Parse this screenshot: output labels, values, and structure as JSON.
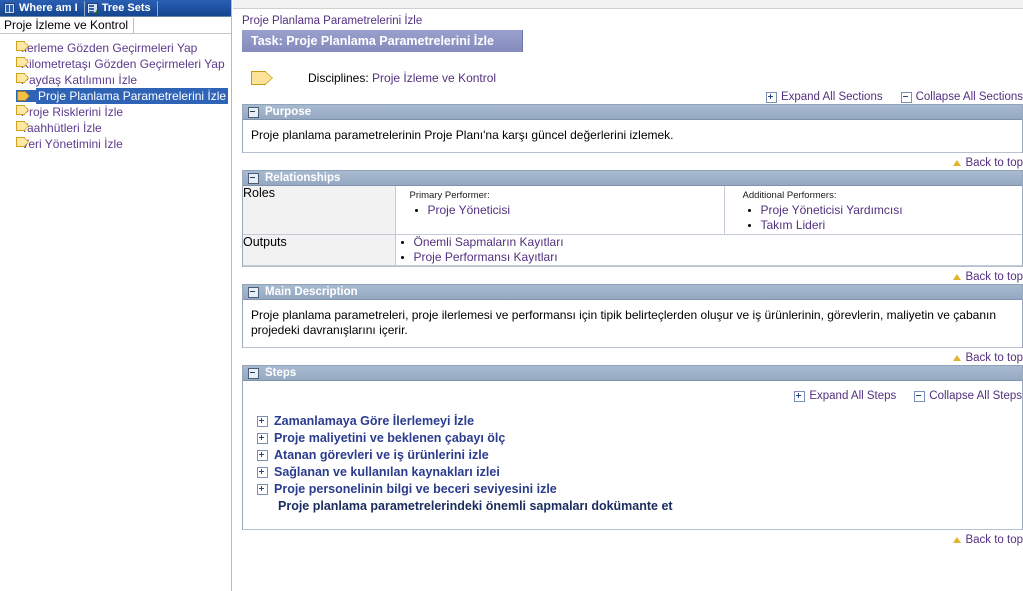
{
  "tree_toolbar": {
    "buttons": [
      {
        "label": "Where am I",
        "icon": "where-am-i-icon"
      },
      {
        "label": "Tree Sets",
        "icon": "tree-sets-icon"
      }
    ]
  },
  "tree": {
    "title": "Proje İzleme ve Kontrol",
    "items": [
      {
        "label": "İlerleme Gözden Geçirmeleri Yap",
        "selected": false
      },
      {
        "label": "Kilometretaşı Gözden Geçirmeleri Yap",
        "selected": false
      },
      {
        "label": "Paydaş Katılımını İzle",
        "selected": false
      },
      {
        "label": "Proje Planlama Parametrelerini İzle",
        "selected": true
      },
      {
        "label": "Proje Risklerini İzle",
        "selected": false
      },
      {
        "label": "Taahhütleri İzle",
        "selected": false
      },
      {
        "label": "Veri Yönetimini İzle",
        "selected": false
      }
    ]
  },
  "main": {
    "breadcrumb": "Proje Planlama Parametrelerini İzle",
    "task_banner": "Task: Proje Planlama Parametrelerini İzle",
    "disciplines_prefix": "Disciplines:",
    "disciplines_value": "Proje İzleme ve Kontrol",
    "expand_all_sections": "Expand All Sections",
    "collapse_all_sections": "Collapse All Sections",
    "back_to_top": "Back to top",
    "sections": {
      "purpose": {
        "title": "Purpose",
        "text": "Proje planlama parametrelerinin Proje Planı'na karşı güncel değerlerini izlemek."
      },
      "relationships": {
        "title": "Relationships",
        "rows": [
          {
            "label": "Roles",
            "primary_caption": "Primary Performer:",
            "primary_items": [
              "Proje Yöneticisi"
            ],
            "additional_caption": "Additional Performers:",
            "additional_items": [
              "Proje Yöneticisi Yardımcısı",
              "Takım Lideri"
            ]
          },
          {
            "label": "Outputs",
            "items": [
              "Önemli Sapmaların Kayıtları",
              "Proje Performansı Kayıtları"
            ]
          }
        ]
      },
      "main_description": {
        "title": "Main Description",
        "text": "Proje planlama parametreleri, proje ilerlemesi ve performansı için tipik belirteçlerden oluşur ve iş ürünlerinin, görevlerin, maliyetin ve çabanın projedeki davranışlarını içerir."
      },
      "steps": {
        "title": "Steps",
        "expand_all_steps": "Expand All Steps",
        "collapse_all_steps": "Collapse All Steps",
        "items": [
          {
            "label": "Zamanlamaya Göre İlerlemeyi İzle",
            "expandable": true
          },
          {
            "label": "Proje maliyetini ve beklenen çabayı ölç",
            "expandable": true
          },
          {
            "label": "Atanan görevleri ve iş ürünlerini izle",
            "expandable": true
          },
          {
            "label": "Sağlanan ve kullanılan kaynakları izlei",
            "expandable": true
          },
          {
            "label": "Proje personelinin bilgi ve beceri seviyesini izle",
            "expandable": true
          },
          {
            "label": "Proje planlama parametrelerindeki önemli sapmaları dokümante et",
            "expandable": false
          }
        ]
      }
    }
  },
  "colors": {
    "toolbar_blue": "#1b4a9c",
    "selection_blue": "#2f63b5",
    "banner_purple": "#8c93c4",
    "section_header": "#9cb0c6",
    "link_purple": "#53307f",
    "step_blue": "#2b3c8f",
    "folder_yellow": "#fde8a8"
  }
}
